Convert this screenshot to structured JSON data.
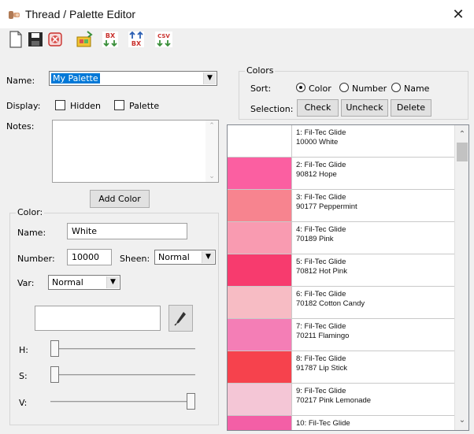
{
  "window": {
    "title": "Thread / Palette Editor",
    "close_glyph": "✕"
  },
  "toolbar": {
    "buttons": [
      {
        "name": "new-icon"
      },
      {
        "name": "save-icon"
      },
      {
        "name": "delete-palette-icon"
      },
      {
        "name": "import-icon"
      },
      {
        "name": "export-bx-icon",
        "text": "BX"
      },
      {
        "name": "import-bx-icon",
        "text": "BX"
      },
      {
        "name": "export-csv-icon",
        "text": "CSV"
      }
    ]
  },
  "palette": {
    "name_label": "Name:",
    "name_value": "My Palette",
    "display_label": "Display:",
    "hidden_label": "Hidden",
    "palette_label": "Palette",
    "notes_label": "Notes:",
    "add_color_label": "Add Color"
  },
  "colors_group": {
    "title": "Colors",
    "sort_label": "Sort:",
    "sort_options": [
      "Color",
      "Number",
      "Name"
    ],
    "sort_selected": "Color",
    "selection_label": "Selection:",
    "check_label": "Check",
    "uncheck_label": "Uncheck",
    "delete_label": "Delete"
  },
  "color_group": {
    "title": "Color:",
    "name_label": "Name:",
    "name_value": "White",
    "number_label": "Number:",
    "number_value": "10000",
    "sheen_label": "Sheen:",
    "sheen_value": "Normal",
    "var_label": "Var:",
    "var_value": "Normal",
    "h_label": "H:",
    "s_label": "S:",
    "v_label": "V:",
    "h_level": 0,
    "s_level": 0,
    "v_level": 1
  },
  "thread_list": [
    {
      "line1": "1: Fil-Tec Glide",
      "line2": "10000 White",
      "color": "#ffffff"
    },
    {
      "line1": "2: Fil-Tec Glide",
      "line2": "90812 Hope",
      "color": "#fb5fa1"
    },
    {
      "line1": "3: Fil-Tec Glide",
      "line2": "90177 Peppermint",
      "color": "#f7848f"
    },
    {
      "line1": "4: Fil-Tec Glide",
      "line2": "70189 Pink",
      "color": "#f99bb1"
    },
    {
      "line1": "5: Fil-Tec Glide",
      "line2": "70812 Hot Pink",
      "color": "#f73b6e"
    },
    {
      "line1": "6: Fil-Tec Glide",
      "line2": "70182 Cotton Candy",
      "color": "#f7bcc4"
    },
    {
      "line1": "7: Fil-Tec Glide",
      "line2": "70211 Flamingo",
      "color": "#f47eb6"
    },
    {
      "line1": "8: Fil-Tec Glide",
      "line2": "91787 Lip Stick",
      "color": "#f6424d"
    },
    {
      "line1": "9: Fil-Tec Glide",
      "line2": "70217 Pink Lemonade",
      "color": "#f4c6d6"
    },
    {
      "line1": "10: Fil-Tec Glide",
      "line2": "",
      "color": "#f35fa6"
    }
  ],
  "scroll": {
    "up_glyph": "⌃",
    "down_glyph": "⌄"
  }
}
